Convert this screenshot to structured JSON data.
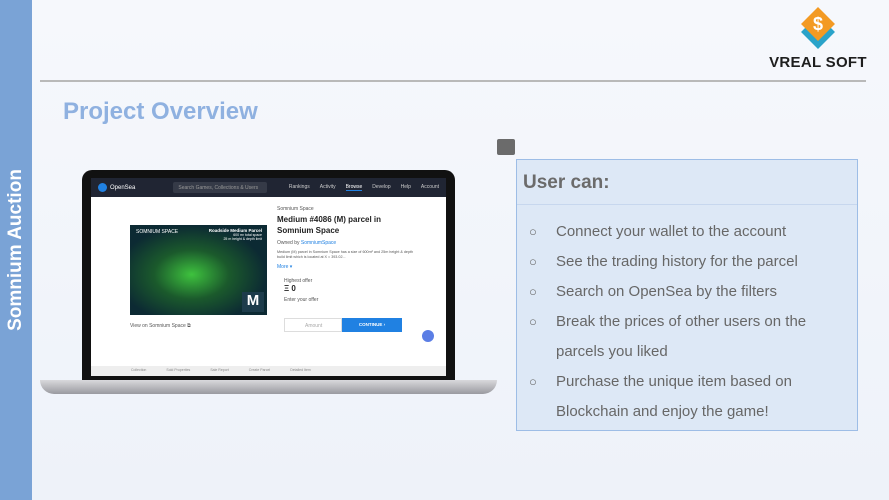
{
  "sidebar_label": "Somnium Auction",
  "logo": {
    "mark": "$",
    "name": "VREAL SOFT"
  },
  "title": "Project Overview",
  "screen": {
    "brand": "OpenSea",
    "search_placeholder": "Search Games, Collections & Users",
    "nav": [
      "Rankings",
      "Activity",
      "Browse",
      "Develop",
      "Help",
      "Account"
    ],
    "image": {
      "brand": "SOMNIUM SPACE",
      "heading": "Roadside Medium Parcel",
      "line1": "600 m² total space",
      "line2": "25 m height & depth limit",
      "size": "M"
    },
    "collection": "Somnium Space",
    "item_title": "Medium #4086 (M) parcel in Somnium Space",
    "owned_prefix": "Owned by",
    "owner": "SomniumSpace",
    "description": "Medium (M) parcel in Somnium Space has a size of 600m² and 25m height & depth build limit which is located at X = 393.02...",
    "more": "More ▾",
    "highest_offer_label": "Highest offer",
    "highest_offer": "Ξ 0",
    "enter_offer_label": "Enter your offer",
    "amount_placeholder": "Amount",
    "continue": "CONTINUE ›",
    "view_link": "View on Somnium Space ⧉",
    "footer": [
      "Collection",
      "Sold Properties",
      "Sale Report",
      "Create Parcel",
      "Detailed Item"
    ]
  },
  "box": {
    "heading": "User can:",
    "bullet": "○",
    "items": [
      "Connect your wallet to the account",
      "See the trading history for the parcel",
      "Search on OpenSea by the filters",
      "Break the prices of other users on the parcels you liked",
      "Purchase the unique item based on Blockchain and enjoy the game!"
    ]
  }
}
